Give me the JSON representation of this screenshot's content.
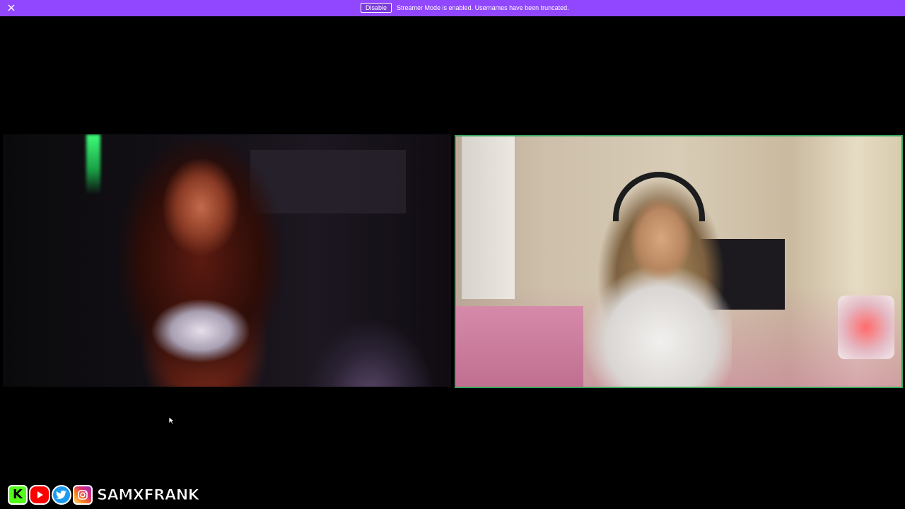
{
  "banner": {
    "background_color": "#9147ff",
    "close_icon": "close-icon",
    "disable_label": "Disable",
    "message": "Streamer Mode is enabled. Usernames have been truncated."
  },
  "cams": {
    "left": {
      "description_icon": "webcam-feed"
    },
    "right": {
      "description_icon": "webcam-feed",
      "border_color": "#3aa55a"
    }
  },
  "socials": {
    "icons": [
      "kick-icon",
      "youtube-icon",
      "twitter-icon",
      "instagram-icon"
    ],
    "kick_letter": "K",
    "handle": "SAMXFRANK"
  }
}
